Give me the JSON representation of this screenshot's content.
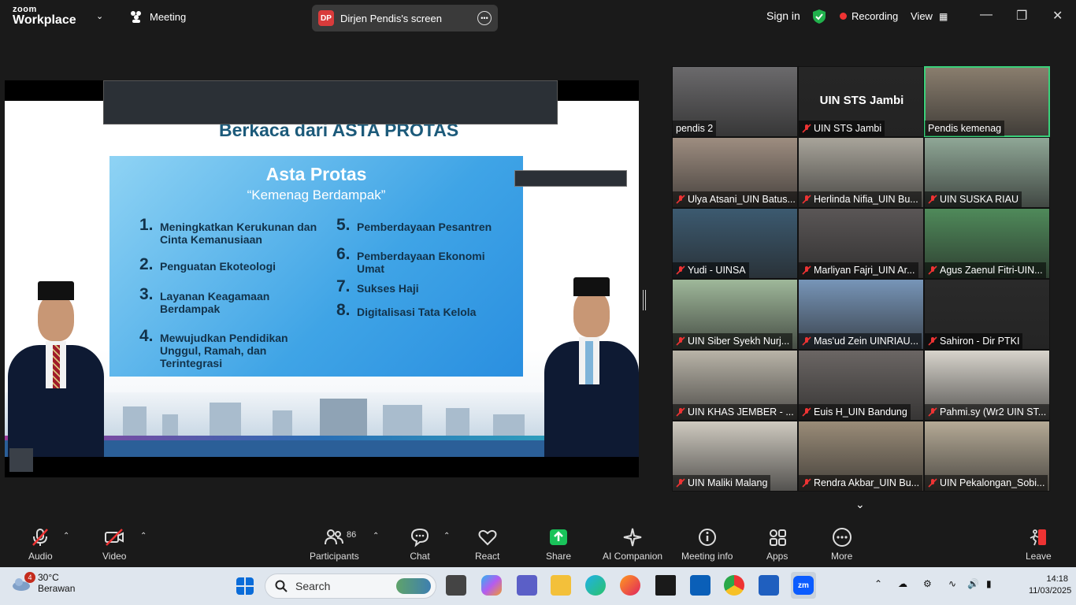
{
  "app": {
    "logo_line1": "zoom",
    "logo_line2": "Workplace",
    "meeting_label": "Meeting",
    "share_initials": "DP",
    "share_label": "Dirjen Pendis's screen",
    "sign_in": "Sign in",
    "recording": "Recording",
    "view": "View"
  },
  "colors": {
    "accent_green": "#3ad17a",
    "record_red": "#e33333",
    "share_badge": "#d93b3b",
    "zoom_blue": "#0b5cff"
  },
  "slide": {
    "title": "Berkaca dari ASTA PROTAS",
    "box_title": "Asta Protas",
    "box_subtitle": "“Kemenag Berdampak”",
    "items": [
      {
        "num": "1.",
        "text": "Meningkatkan Kerukunan dan Cinta Kemanusiaan"
      },
      {
        "num": "2.",
        "text": "Penguatan Ekoteologi"
      },
      {
        "num": "3.",
        "text": "Layanan Keagamaan Berdampak"
      },
      {
        "num": "4.",
        "text": "Mewujudkan Pendidikan Unggul, Ramah, dan Terintegrasi"
      },
      {
        "num": "5.",
        "text": "Pemberdayaan Pesantren"
      },
      {
        "num": "6.",
        "text": "Pemberdayaan Ekonomi Umat"
      },
      {
        "num": "7.",
        "text": "Sukses Haji"
      },
      {
        "num": "8.",
        "text": "Digitalisasi Tata Kelola"
      }
    ]
  },
  "gallery": [
    {
      "name": "pendis 2",
      "muted": false,
      "bg": "#6b6a6c"
    },
    {
      "name": "UIN STS Jambi",
      "muted": true,
      "bg": "#262626",
      "label": "UIN STS Jambi"
    },
    {
      "name": "Pendis kemenag",
      "muted": false,
      "bg": "#8a7e6e",
      "active": true
    },
    {
      "name": "Ulya Atsani_UIN Batus...",
      "muted": true,
      "bg": "#9e8d80"
    },
    {
      "name": "Herlinda Nifia_UIN Bu...",
      "muted": true,
      "bg": "#a8a49a"
    },
    {
      "name": "UIN SUSKA RIAU",
      "muted": true,
      "bg": "#8fa796"
    },
    {
      "name": "Yudi - UINSA",
      "muted": true,
      "bg": "#3c5a70"
    },
    {
      "name": "Marliyan Fajri_UIN Ar...",
      "muted": true,
      "bg": "#5a5656"
    },
    {
      "name": "Agus Zaenul Fitri-UIN...",
      "muted": true,
      "bg": "#4f8a5a"
    },
    {
      "name": "UIN Siber Syekh Nurj...",
      "muted": true,
      "bg": "#9fb89a"
    },
    {
      "name": "Mas'ud Zein UINRIAU...",
      "muted": true,
      "bg": "#7795b8"
    },
    {
      "name": "Sahiron - Dir PTKI",
      "muted": true,
      "bg": "#2a2a2a"
    },
    {
      "name": "UIN KHAS JEMBER - ...",
      "muted": true,
      "bg": "#b9b4a8"
    },
    {
      "name": "Euis H_UIN Bandung",
      "muted": true,
      "bg": "#6b6664"
    },
    {
      "name": "Pahmi.sy (Wr2 UIN ST...",
      "muted": true,
      "bg": "#d8d4cc"
    },
    {
      "name": "UIN Maliki Malang",
      "muted": true,
      "bg": "#cfcac0"
    },
    {
      "name": "Rendra Akbar_UIN Bu...",
      "muted": true,
      "bg": "#9a8c78"
    },
    {
      "name": "UIN Pekalongan_Sobi...",
      "muted": true,
      "bg": "#b5aa96"
    }
  ],
  "toolbar": {
    "audio": "Audio",
    "video": "Video",
    "participants": "Participants",
    "participants_count": "86",
    "chat": "Chat",
    "react": "React",
    "share": "Share",
    "ai": "AI Companion",
    "info": "Meeting info",
    "apps": "Apps",
    "more": "More",
    "leave": "Leave"
  },
  "taskbar": {
    "weather_badge": "4",
    "temp": "30°C",
    "condition": "Berawan",
    "search": "Search",
    "time": "14:18",
    "date": "11/03/2025"
  }
}
